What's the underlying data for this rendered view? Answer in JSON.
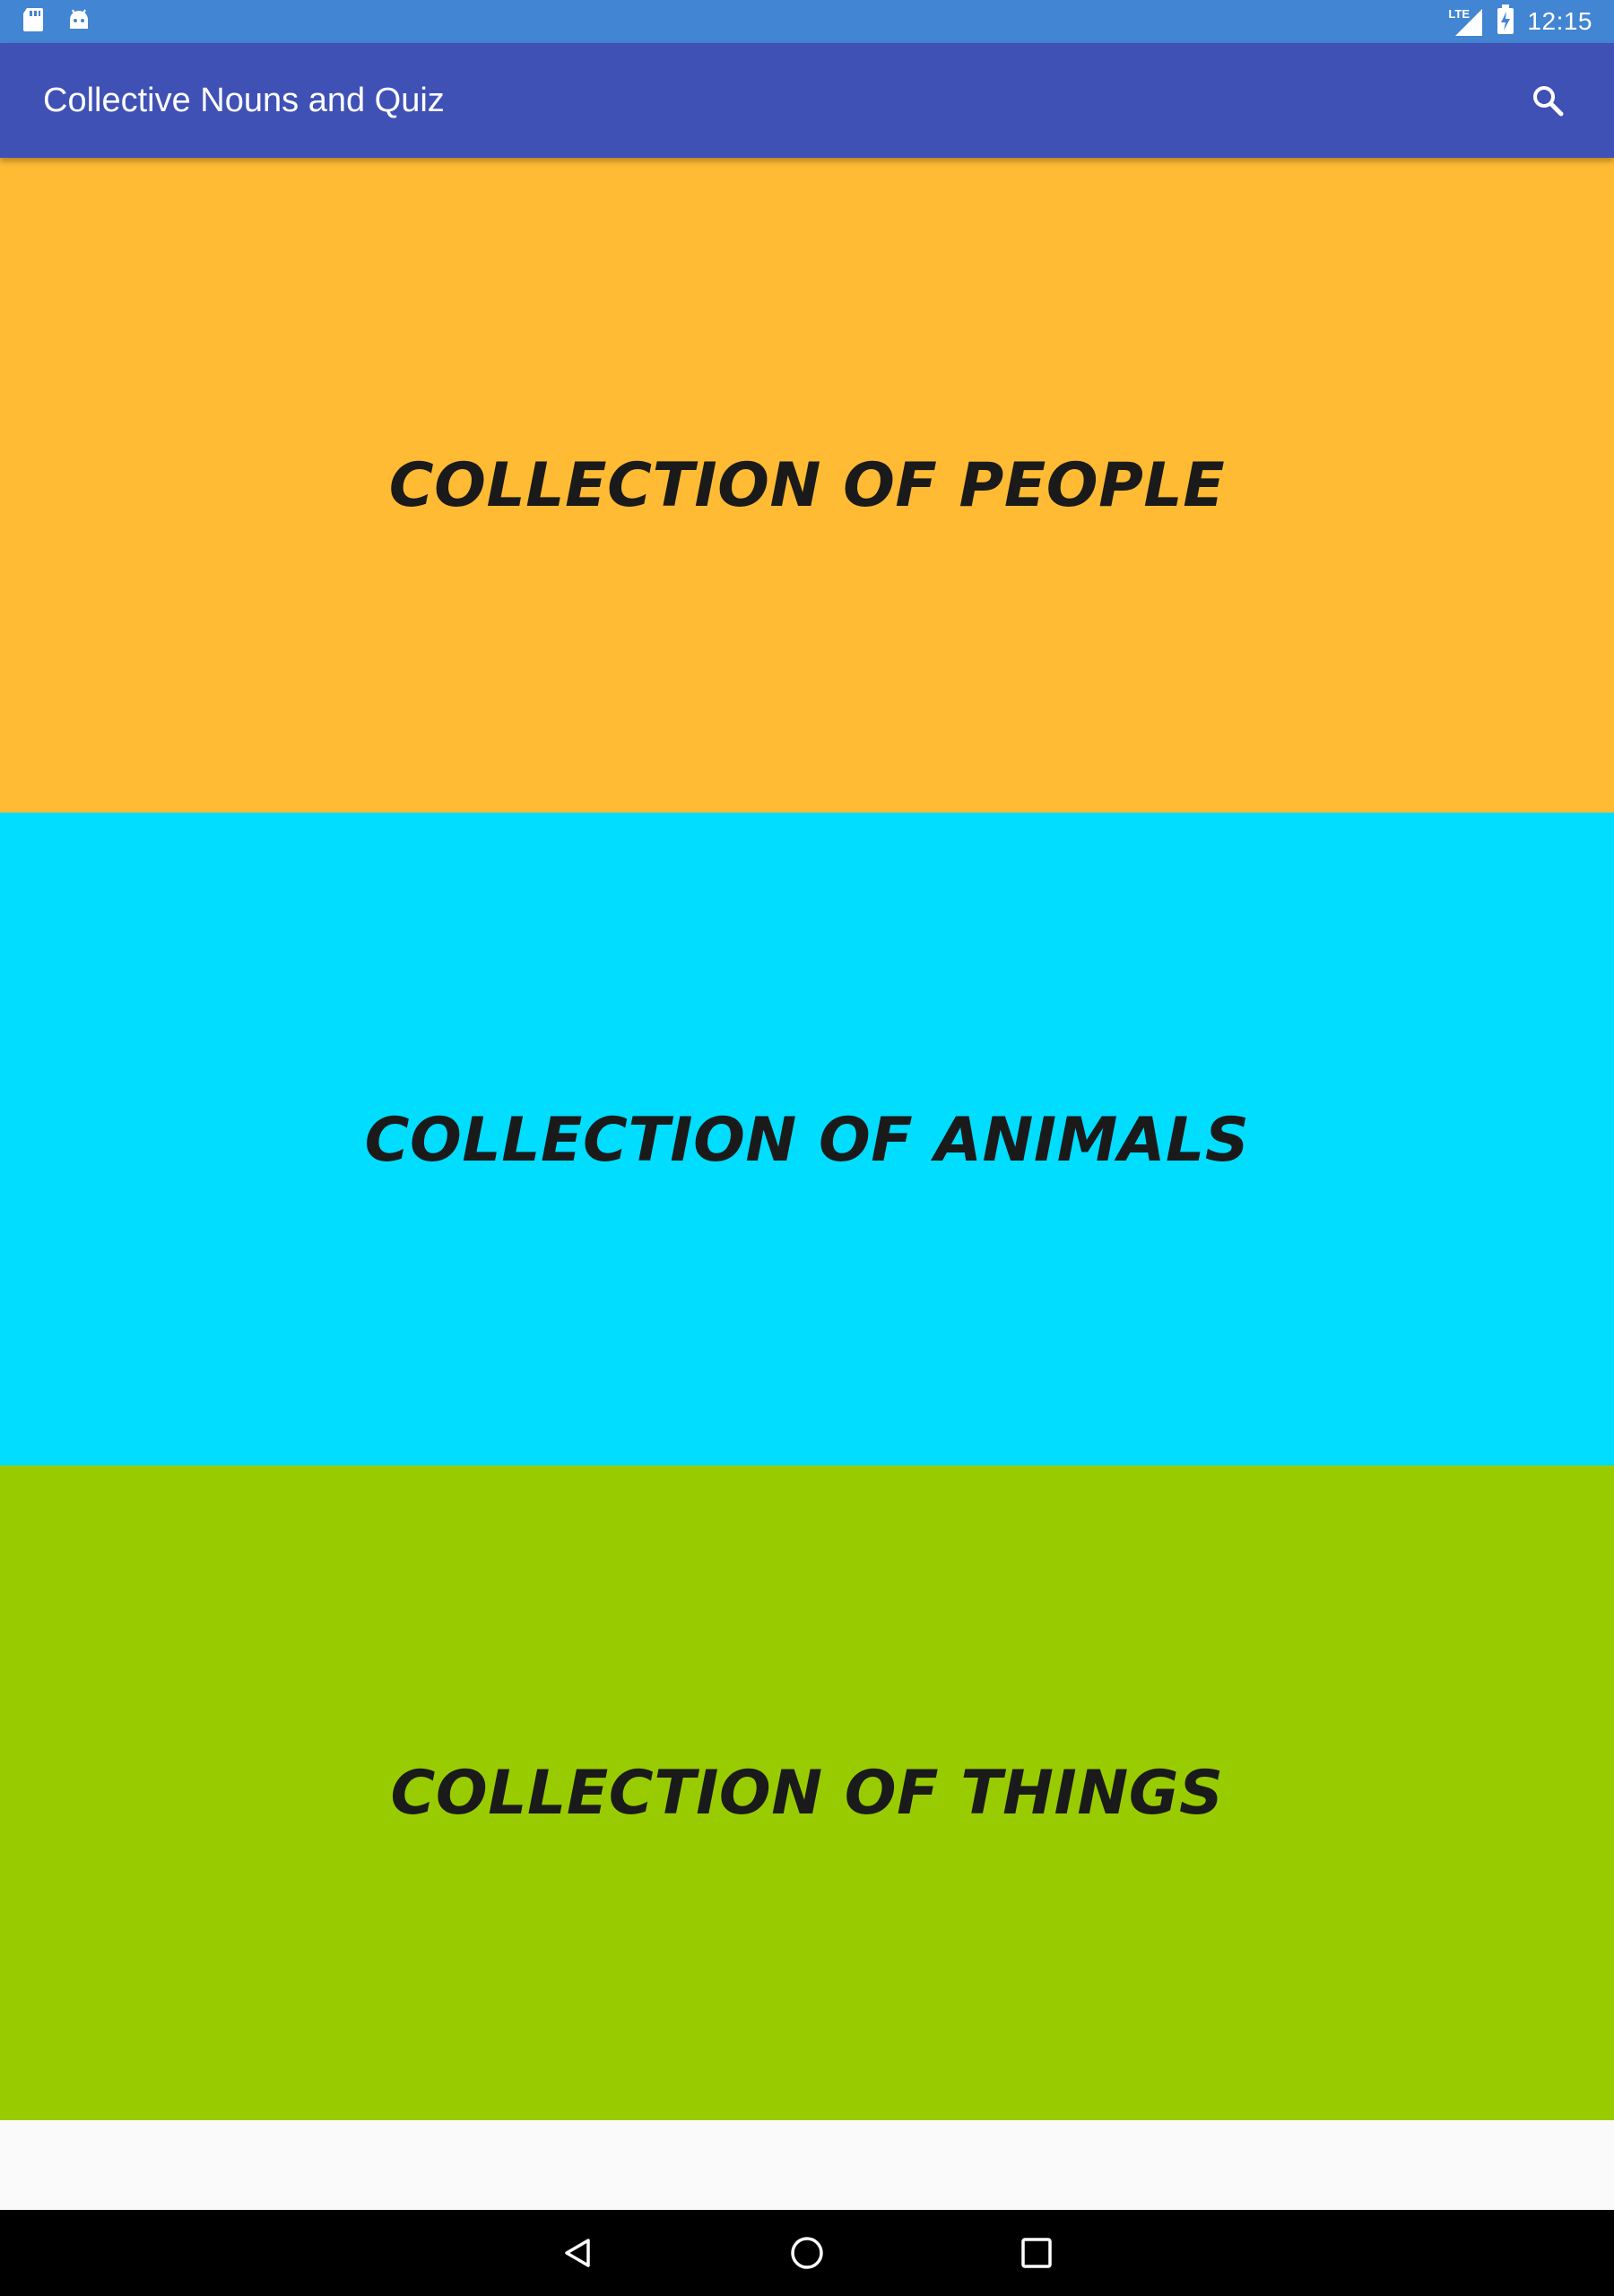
{
  "status_bar": {
    "time": "12:15",
    "network_label": "LTE",
    "left_icons": [
      "sd-card-icon",
      "android-icon"
    ],
    "right_icons": [
      "lte-signal-icon",
      "battery-charging-icon"
    ]
  },
  "app_bar": {
    "title": "Collective Nouns and Quiz",
    "color": "#3f51b5",
    "search_icon": "search-icon"
  },
  "categories": [
    {
      "label": "COLLECTION OF PEOPLE",
      "color": "#ffbb33"
    },
    {
      "label": "COLLECTION OF ANIMALS",
      "color": "#00ddff"
    },
    {
      "label": "COLLECTION OF THINGS",
      "color": "#99cc00"
    }
  ],
  "nav_bar": {
    "buttons": [
      "back-icon",
      "home-icon",
      "recents-icon"
    ]
  }
}
